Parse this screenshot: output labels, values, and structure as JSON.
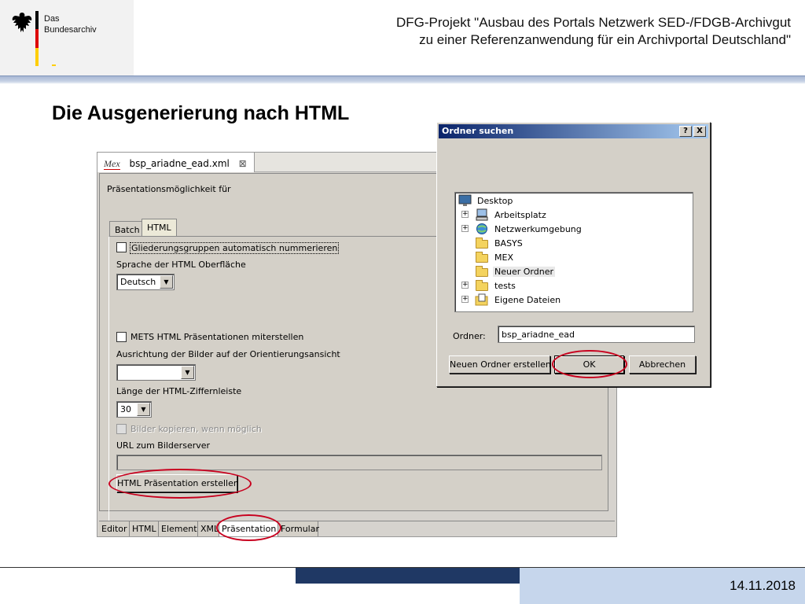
{
  "slide": {
    "logo_line1": "Das",
    "logo_line2": "Bundesarchiv",
    "header_line1": "DFG-Projekt \"Ausbau des Portals Netzwerk SED-/FDGB-Archivgut",
    "header_line2": "zu einer Referenzanwendung für ein Archivportal Deutschland\"",
    "title": "Die Ausgenerierung nach HTML",
    "date": "14.11.2018"
  },
  "editor": {
    "tab_prefix": "Mex",
    "tab_label": "bsp_ariadne_ead.xml",
    "tab_close": "⊠",
    "section_label": "Präsentationsmöglichkeit für",
    "subtabs": [
      "Batch",
      "HTML"
    ],
    "chk_gliederung": "Gliederungsgruppen automatisch nummerieren",
    "label_sprache": "Sprache der HTML Oberfläche",
    "sprache_value": "Deutsch",
    "chk_mets": "METS HTML Präsentationen miterstellen",
    "label_ausrichtung": "Ausrichtung der Bilder auf der Orientierungsansicht",
    "ausrichtung_value": "",
    "label_laenge": "Länge der HTML-Ziffernleiste",
    "laenge_value": "30",
    "chk_bilder": "Bilder kopieren, wenn möglich",
    "label_url": "URL zum Bilderserver",
    "btn_create": "HTML Präsentation erstellen",
    "bottom_tabs": [
      "Editor",
      "HTML",
      "Element",
      "XML",
      "Präsentation",
      "Formular"
    ]
  },
  "dialog": {
    "title": "Ordner suchen",
    "help": "?",
    "close": "X",
    "tree": [
      {
        "label": "Desktop",
        "icon": "desktop-icon",
        "expander": false
      },
      {
        "label": "Arbeitsplatz",
        "icon": "computer-icon",
        "expander": true
      },
      {
        "label": "Netzwerkumgebung",
        "icon": "network-icon",
        "expander": true
      },
      {
        "label": "BASYS",
        "icon": "folder-icon",
        "expander": false
      },
      {
        "label": "MEX",
        "icon": "folder-icon",
        "expander": false
      },
      {
        "label": "Neuer Ordner",
        "icon": "folder-icon",
        "expander": false,
        "selected": true
      },
      {
        "label": "tests",
        "icon": "folder-icon",
        "expander": true
      },
      {
        "label": "Eigene Dateien",
        "icon": "documents-icon",
        "expander": true
      }
    ],
    "ordner_label": "Ordner:",
    "ordner_value": "bsp_ariadne_ead",
    "btn_new": "Neuen Ordner erstellen",
    "btn_ok": "OK",
    "btn_cancel": "Abbrechen"
  },
  "colors": {
    "title_bar_start": "#0a246a",
    "highlight_ring": "#c8001e",
    "footer_dark": "#1f3864",
    "footer_light": "#c6d6ec"
  }
}
